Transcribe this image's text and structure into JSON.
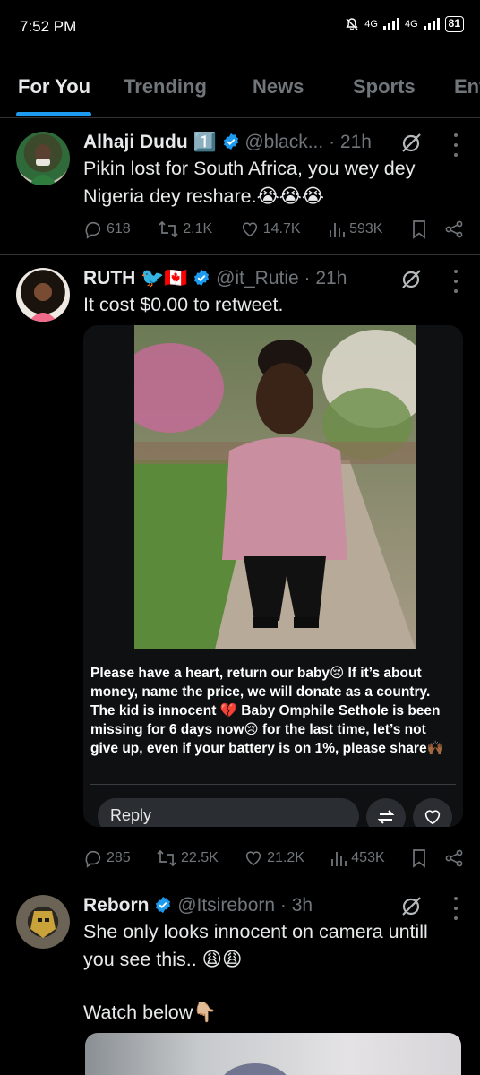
{
  "status_bar": {
    "time": "7:52 PM",
    "network_1": "4G",
    "network_2": "4G",
    "battery": "81"
  },
  "tabs": [
    {
      "label": "For You",
      "active": true
    },
    {
      "label": "Trending",
      "active": false
    },
    {
      "label": "News",
      "active": false
    },
    {
      "label": "Sports",
      "active": false
    },
    {
      "label": "Ent",
      "active": false
    }
  ],
  "colors": {
    "accent": "#1d9bf0",
    "verified_gold": "#e2b719",
    "muted": "#71767b",
    "background": "#000000"
  },
  "tweets": [
    {
      "name": "Alhaji Dudu",
      "name_badge": "1️⃣",
      "handle": "@black...",
      "time": "21h",
      "text": "Pikin lost for South Africa, you wey dey Nigeria dey reshare.😭😭😭",
      "stats": {
        "replies": "618",
        "retweets": "2.1K",
        "likes": "14.7K",
        "views": "593K"
      }
    },
    {
      "name": "RUTH",
      "name_badge": "🐦🇨🇦",
      "handle": "@it_Rutie",
      "time": "21h",
      "text": "It cost $0.00 to retweet.",
      "media_caption": "Please have a heart, return our baby😢 If it’s about money, name the price, we will donate as a country. The kid is innocent 💔 Baby Omphile Sethole is been missing for 6 days now😢 for the last time, let’s not give up, even if your battery is on 1%, please share🙌🏾",
      "reply_label": "Reply",
      "stats": {
        "replies": "285",
        "retweets": "22.5K",
        "likes": "21.2K",
        "views": "453K"
      }
    },
    {
      "name": "Reborn",
      "handle": "@Itsireborn",
      "time": "3h",
      "text_line1": "She only looks innocent  on camera untill you see this.. 😩😩",
      "text_line2": "Watch below👇🏼"
    }
  ],
  "icons": [
    "grok-icon",
    "more-icon",
    "reply-icon",
    "retweet-icon",
    "like-icon",
    "views-icon",
    "bookmark-icon",
    "share-icon",
    "verified-icon"
  ]
}
